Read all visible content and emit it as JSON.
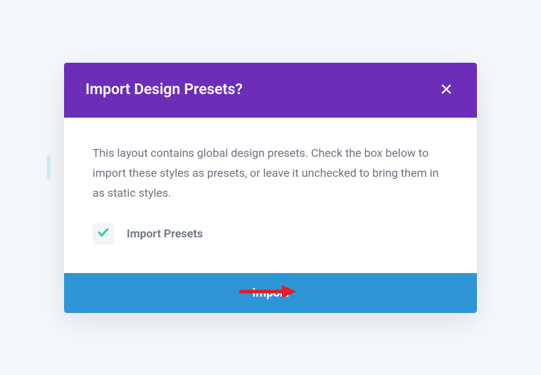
{
  "modal": {
    "title": "Import Design Presets?",
    "description": "This layout contains global design presets. Check the box below to import these styles as presets, or leave it unchecked to bring them in as static styles.",
    "checkbox": {
      "label": "Import Presets",
      "checked": true
    },
    "footer": {
      "button_label": "Import"
    }
  },
  "colors": {
    "header_bg": "#6c2eb9",
    "footer_bg": "#2e96d6",
    "check_color": "#2dc4a3",
    "arrow_color": "#e31b23"
  }
}
